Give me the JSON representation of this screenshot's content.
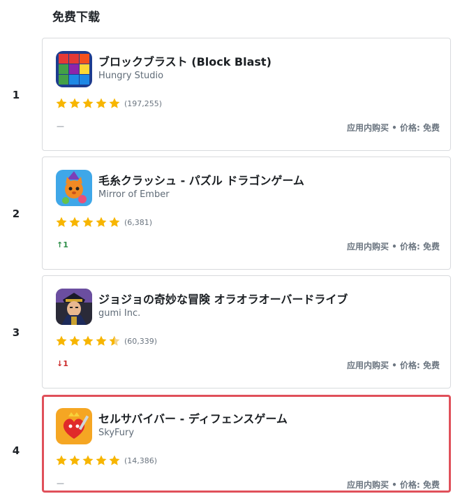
{
  "section": {
    "title": "免费下载"
  },
  "colors": {
    "star": "#f7b500",
    "highlight_border": "#e0505a",
    "up": "#2f8f4a",
    "down": "#cc2b2b"
  },
  "apps": [
    {
      "rank": "1",
      "name": "ブロックブラスト (Block Blast)",
      "developer": "Hungry Studio",
      "rating": 5,
      "reviews": "(197,255)",
      "change": "—",
      "change_dir": "none",
      "price_text": "应用内购买 • 价格: 免费",
      "icon": "block-blast-icon"
    },
    {
      "rank": "2",
      "name": "毛糸クラッシュ - パズル ドラゴンゲーム",
      "developer": "Mirror of Ember",
      "rating": 5,
      "reviews": "(6,381)",
      "change": "↑1",
      "change_dir": "up",
      "price_text": "应用内购买 • 价格: 免费",
      "icon": "yarn-cat-icon"
    },
    {
      "rank": "3",
      "name": "ジョジョの奇妙な冒険 オラオラオーバードライブ",
      "developer": "gumi Inc.",
      "rating": 4.5,
      "reviews": "(60,339)",
      "change": "↓1",
      "change_dir": "down",
      "price_text": "应用内购买 • 价格: 免费",
      "icon": "jojo-character-icon"
    },
    {
      "rank": "4",
      "name": "セルサバイバー - ディフェンスゲーム",
      "developer": "SkyFury",
      "rating": 5,
      "reviews": "(14,386)",
      "change": "—",
      "change_dir": "none",
      "price_text": "应用内购买 • 价格: 免费",
      "icon": "heart-knight-icon"
    }
  ]
}
